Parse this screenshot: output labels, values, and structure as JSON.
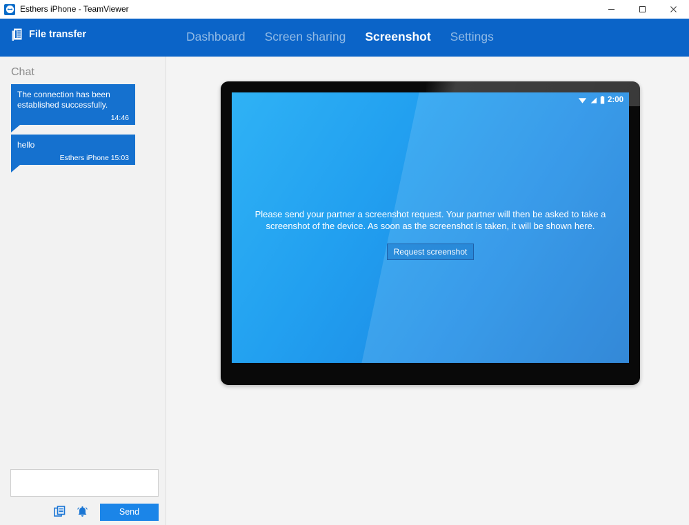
{
  "window": {
    "title": "Esthers iPhone - TeamViewer",
    "logo_icon": "teamviewer-logo-icon",
    "controls": {
      "minimize": "minimize-icon",
      "maximize": "maximize-icon",
      "close": "close-icon"
    }
  },
  "header": {
    "mode_icon": "file-transfer-icon",
    "mode_label": "File transfer",
    "accent_color": "#0b64c8",
    "tabs": [
      {
        "label": "Dashboard",
        "active": false
      },
      {
        "label": "Screen sharing",
        "active": false
      },
      {
        "label": "Screenshot",
        "active": true
      },
      {
        "label": "Settings",
        "active": false
      }
    ]
  },
  "sidebar": {
    "title": "Chat",
    "messages": [
      {
        "text": "The connection has been established successfully.",
        "meta": "14:46"
      },
      {
        "text": "hello",
        "meta": "Esthers iPhone 15:03"
      }
    ],
    "composer": {
      "value": "",
      "placeholder": "",
      "attach_icon": "copy-documents-icon",
      "nudge_icon": "bell-icon",
      "send_label": "Send",
      "send_color": "#1b85e8"
    }
  },
  "main": {
    "device": {
      "status_bar": {
        "wifi_icon": "wifi-icon",
        "signal_icon": "signal-icon",
        "battery_icon": "battery-icon",
        "time": "2:00"
      },
      "screen_message": "Please send your partner a screenshot request. Your partner will then be asked to take a screenshot of the device. As soon as the screenshot is taken, it will be shown here.",
      "request_button_label": "Request screenshot"
    }
  }
}
